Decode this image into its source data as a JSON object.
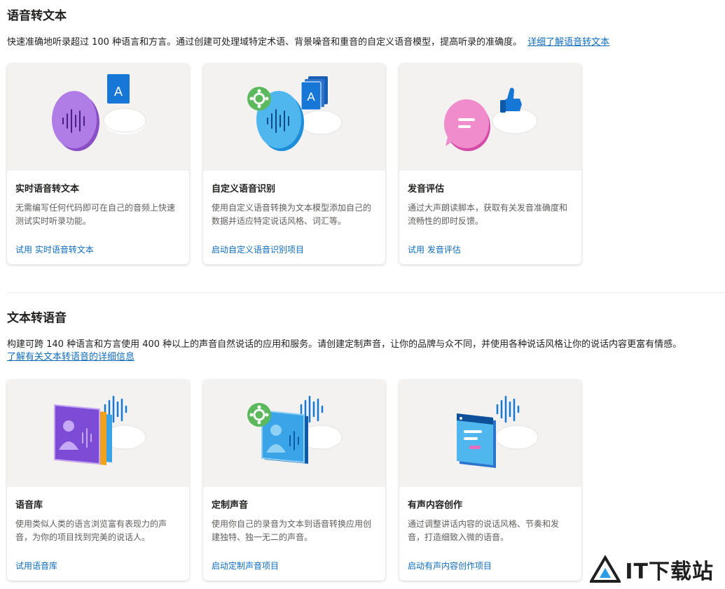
{
  "stt": {
    "title": "语音转文本",
    "description": "快速准确地听录超过 100 种语言和方言。通过创建可处理域特定术语、背景噪音和重音的自定义语音模型，提高听录的准确度。",
    "learn_more": "详细了解语音转文本",
    "cards": [
      {
        "title": "实时语音转文本",
        "description": "无需编写任何代码即可在自己的音频上快速测试实时听录功能。",
        "link": "试用 实时语音转文本",
        "icon": "microphone-text-icon"
      },
      {
        "title": "自定义语音识别",
        "description": "使用自定义语音转换为文本模型添加自己的数据并适应特定说话风格、词汇等。",
        "link": "启动自定义语音识别项目",
        "icon": "custom-speech-icon"
      },
      {
        "title": "发音评估",
        "description": "通过大声朗读脚本，获取有关发音准确度和流畅性的即时反馈。",
        "link": "试用 发音评估",
        "icon": "pronunciation-icon"
      }
    ]
  },
  "tts": {
    "title": "文本转语音",
    "description": "构建可跨 140 种语言和方言使用 400 种以上的声音自然说话的应用和服务。请创建定制声音，让你的品牌与众不同，并使用各种说话风格让你的说话内容更富有情感。",
    "learn_more": "了解有关文本转语音的详细信息",
    "cards": [
      {
        "title": "语音库",
        "description": "使用类似人类的语言浏览富有表现力的声音，为你的项目找到完美的说话人。",
        "link": "试用语音库",
        "icon": "voice-gallery-icon"
      },
      {
        "title": "定制声音",
        "description": "使用你自己的录音为文本到语音转换应用创建独特、独一无二的声音。",
        "link": "启动定制声音项目",
        "icon": "custom-voice-icon"
      },
      {
        "title": "有声内容创作",
        "description": "通过调整讲话内容的说话风格、节奏和发音，打造细致入微的语音。",
        "link": "启动有声内容创作项目",
        "icon": "audio-content-icon"
      }
    ]
  },
  "watermark": "IT下载站",
  "colors": {
    "link": "#0f6cbd",
    "card_image_bg": "#f3f2f1",
    "purple": "#9b5fd6",
    "blue": "#1677d6",
    "pink": "#e66cbd",
    "green": "#5cb85c"
  }
}
